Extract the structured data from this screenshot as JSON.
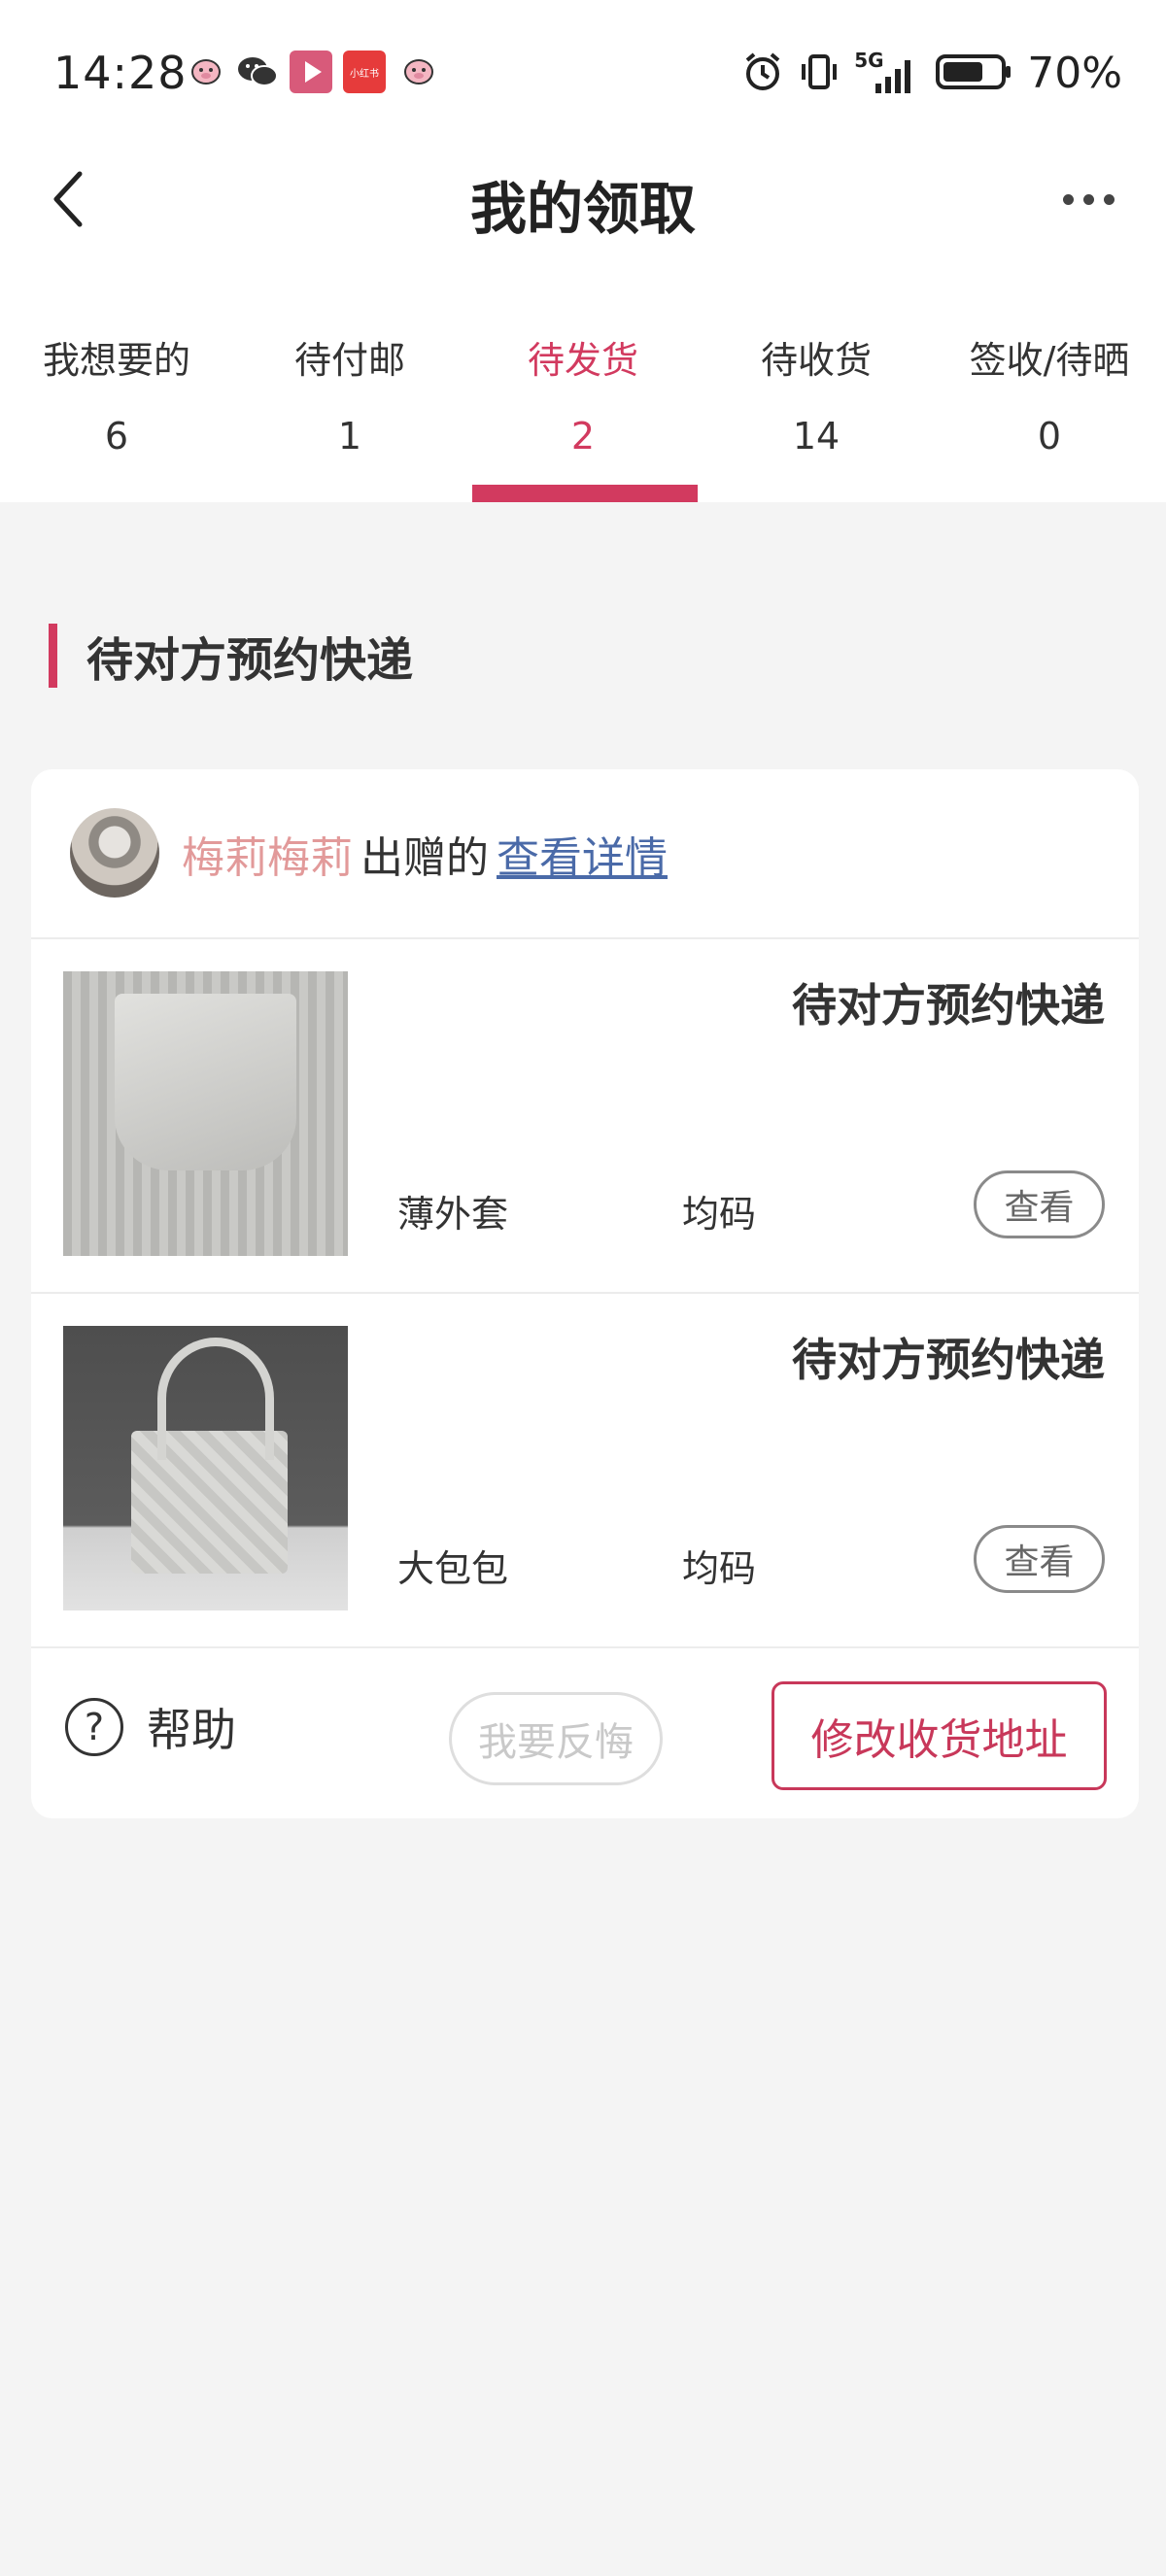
{
  "status_bar": {
    "time": "14:28",
    "battery_pct": "70%",
    "network": "5G",
    "notification_icons": [
      "pig-app-icon",
      "wechat-icon",
      "video-app-icon",
      "xiaohongshu-icon",
      "pig-app-icon"
    ],
    "xiaohongshu_label": "小红书"
  },
  "nav": {
    "title": "我的领取"
  },
  "tabs": [
    {
      "label": "我想要的",
      "count": "6"
    },
    {
      "label": "待付邮",
      "count": "1"
    },
    {
      "label": "待发货",
      "count": "2",
      "active": true
    },
    {
      "label": "待收货",
      "count": "14"
    },
    {
      "label": "签收/待晒",
      "count": "0"
    }
  ],
  "section": {
    "title": "待对方预约快递"
  },
  "card": {
    "giver_name": "梅莉梅莉",
    "giver_suffix": "出赠的",
    "detail_link": "查看详情",
    "items": [
      {
        "status": "待对方预约快递",
        "name": "薄外套",
        "size": "均码",
        "view_label": "查看"
      },
      {
        "status": "待对方预约快递",
        "name": "大包包",
        "size": "均码",
        "view_label": "查看"
      }
    ],
    "footer": {
      "help_label": "帮助",
      "regret_label": "我要反悔",
      "address_label": "修改收货地址"
    }
  },
  "colors": {
    "accent": "#d23a5f",
    "giver_name": "#e29a9a",
    "link": "#4a6aa8",
    "background": "#f4f4f4"
  }
}
